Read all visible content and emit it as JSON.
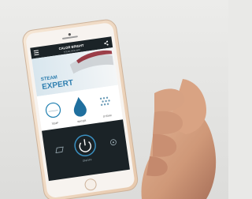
{
  "app": {
    "brand": "CALOR BRIGHT",
    "brand_sub": "STEAM IRON APP",
    "menu_icon": "hamburger-menu-icon",
    "share_icon": "share-icon"
  },
  "hero": {
    "line1": "STEAM",
    "line2": "EXPERT"
  },
  "features": [
    {
      "icon": "gauge-icon",
      "label": "TEMP"
    },
    {
      "icon": "water-drop-icon",
      "label": "WATER"
    },
    {
      "icon": "steam-dots-icon",
      "label": "STEAM"
    }
  ],
  "control_panel": {
    "power_icon": "power-icon",
    "left_icon": "steam-shot-icon",
    "right_icon": "settings-icon",
    "power_caption": "ON/OFF"
  },
  "colors": {
    "background": "#e9e9e7",
    "phone_body": "#f0d9c4",
    "screen_dark": "#1b2327",
    "accent_blue": "#1f7fb0"
  }
}
